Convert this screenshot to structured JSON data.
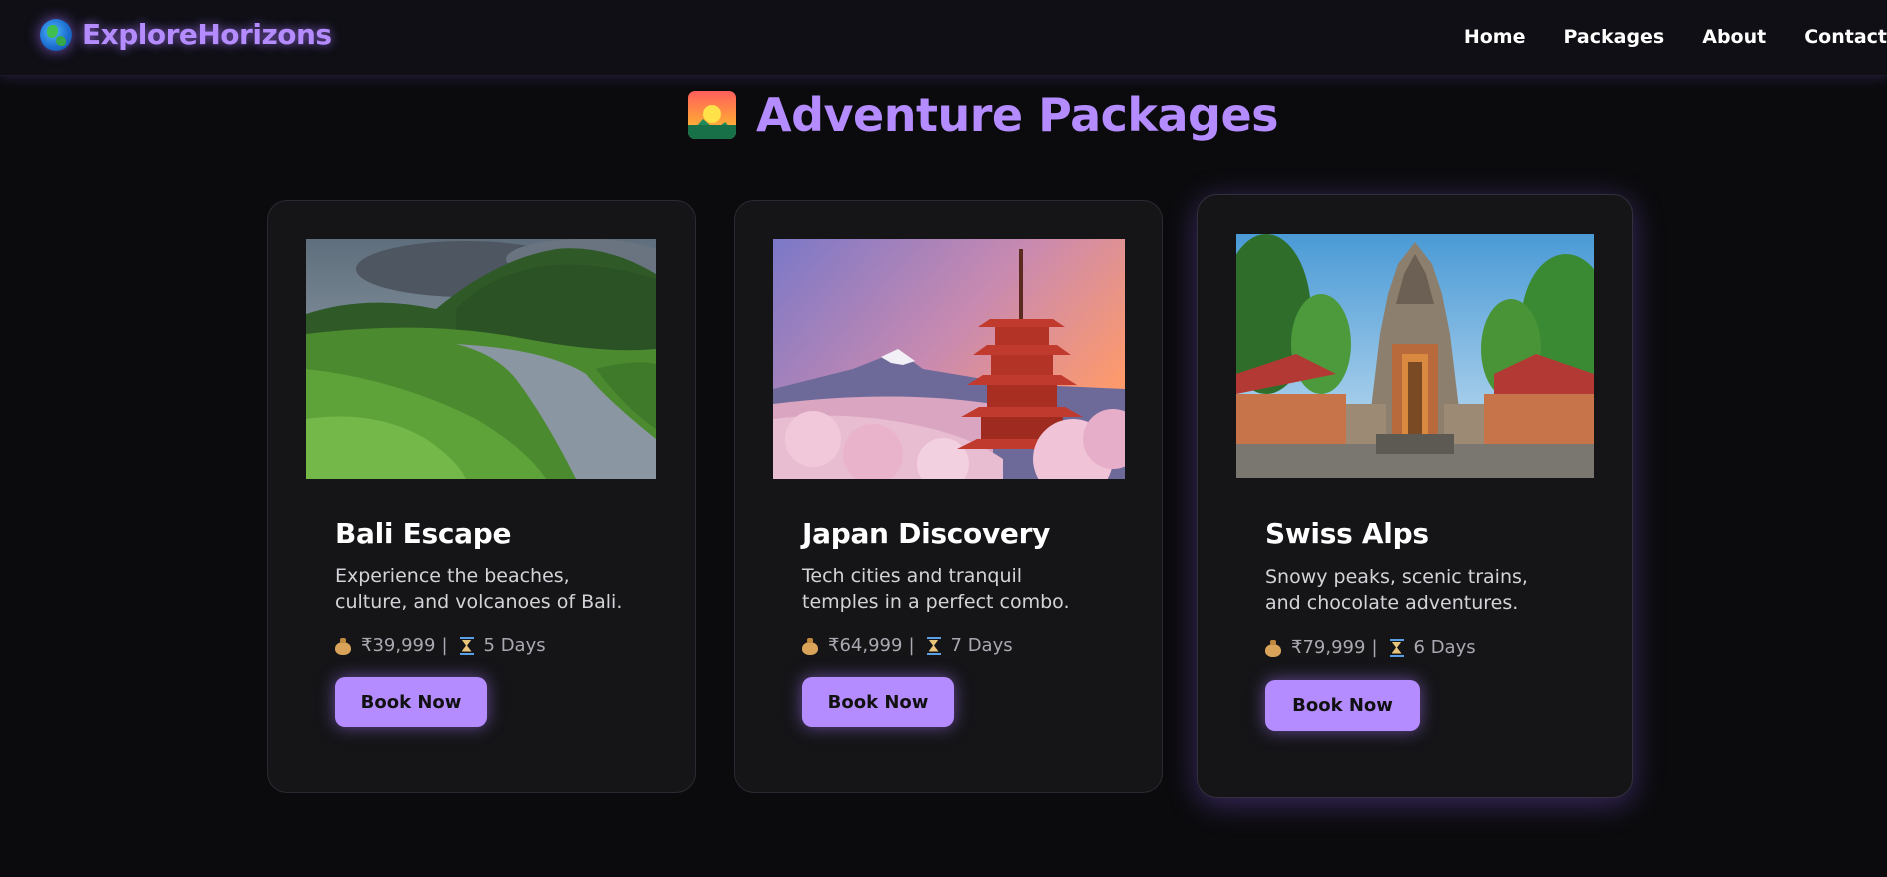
{
  "brand": {
    "name": "ExploreHorizons",
    "icon": "globe-icon"
  },
  "nav": {
    "links": [
      "Home",
      "Packages",
      "About",
      "Contact"
    ]
  },
  "page": {
    "title": "Adventure Packages",
    "title_icon": "sunrise-mountain-icon"
  },
  "colors": {
    "accent": "#b48cff",
    "background": "#0b0b0d",
    "card": "#151518"
  },
  "packages": [
    {
      "title": "Bali Escape",
      "description": "Experience the beaches, culture, and volcanoes of Bali.",
      "price": "₹39,999",
      "separator": "|",
      "duration": "5 Days",
      "button": "Book Now"
    },
    {
      "title": "Japan Discovery",
      "description": "Tech cities and tranquil temples in a perfect combo.",
      "price": "₹64,999",
      "separator": "|",
      "duration": "7 Days",
      "button": "Book Now"
    },
    {
      "title": "Swiss Alps",
      "description": "Snowy peaks, scenic trains, and chocolate adventures.",
      "price": "₹79,999",
      "separator": "|",
      "duration": "6 Days",
      "button": "Book Now"
    }
  ]
}
